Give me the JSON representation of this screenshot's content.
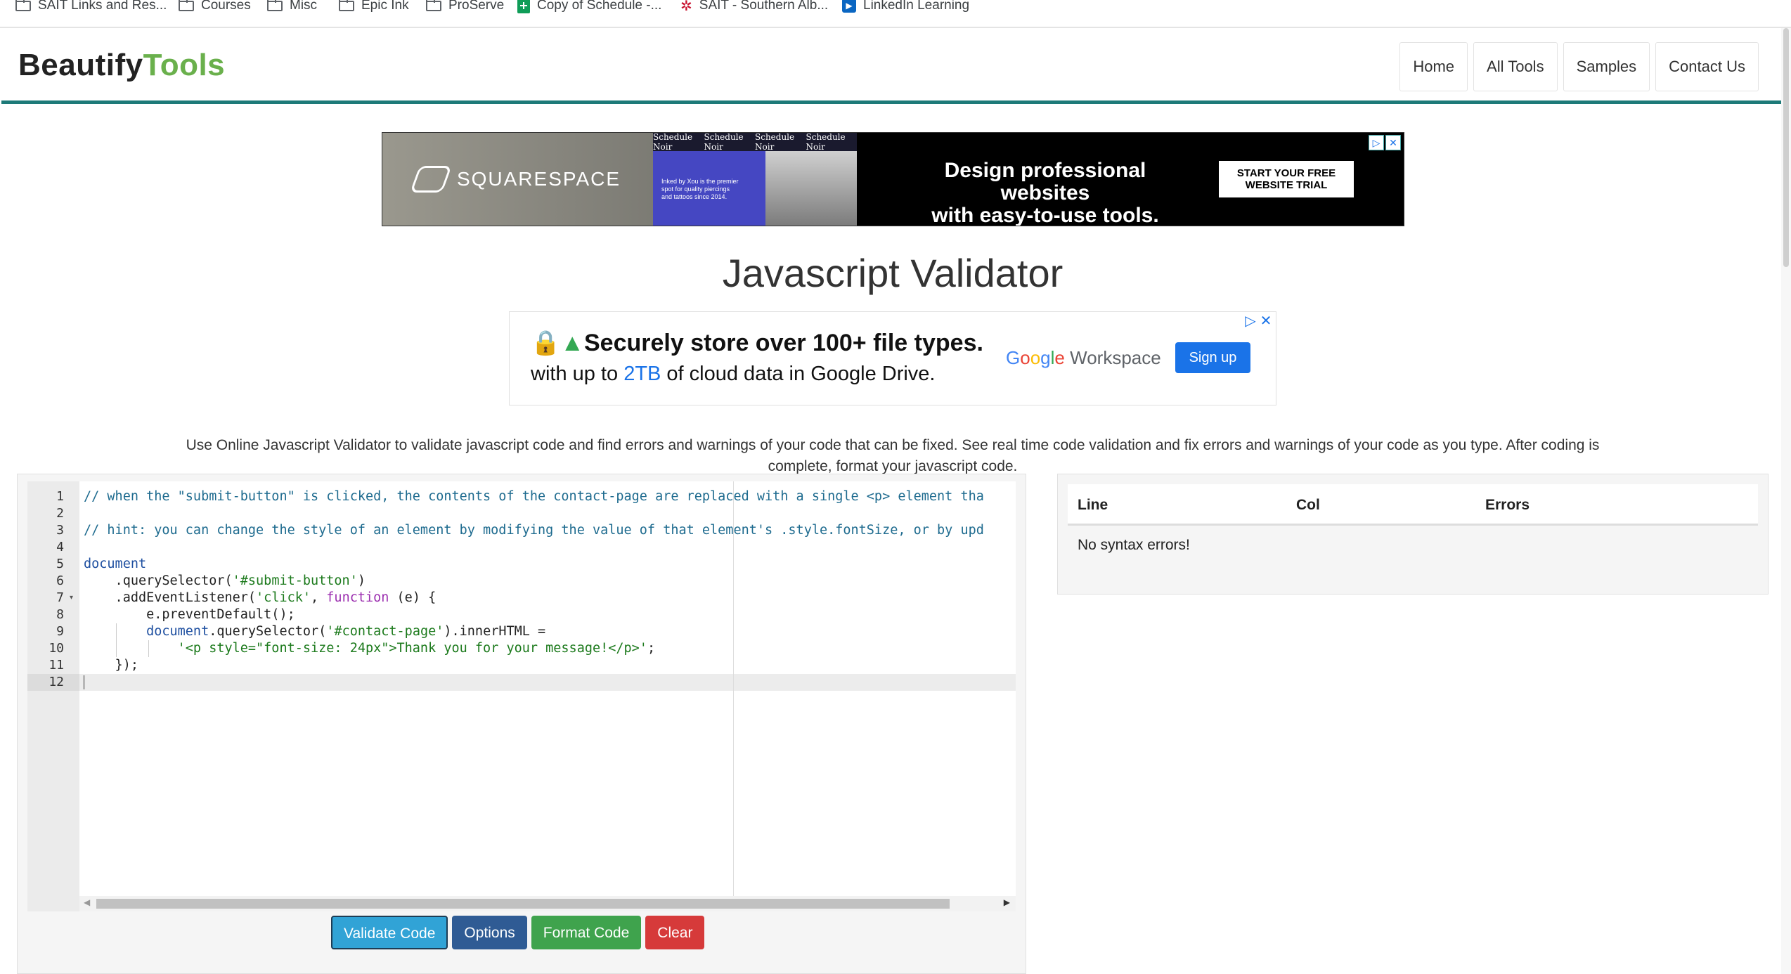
{
  "bookmarks": [
    {
      "label": "SAIT Links and Res...",
      "icon": "folder-icon"
    },
    {
      "label": "Courses",
      "icon": "folder-icon"
    },
    {
      "label": "Misc",
      "icon": "folder-icon"
    },
    {
      "label": "Epic Ink",
      "icon": "folder-icon"
    },
    {
      "label": "ProServe",
      "icon": "folder-icon"
    },
    {
      "label": "Copy of Schedule -...",
      "icon": "sheets-icon"
    },
    {
      "label": "SAIT - Southern Alb...",
      "icon": "sait-icon"
    },
    {
      "label": "LinkedIn Learning",
      "icon": "linkedin-learning-icon"
    }
  ],
  "logo": {
    "part1": "Beautify",
    "part2": "Tools"
  },
  "nav": {
    "home": "Home",
    "all_tools": "All Tools",
    "samples": "Samples",
    "contact": "Contact Us"
  },
  "ad1": {
    "brand": "SQUARESPACE",
    "strip_items": [
      "Schedule Noir",
      "Schedule Noir",
      "Schedule Noir",
      "Schedule Noir"
    ],
    "small_text": "Inked by Xou is the premier spot for quality piercings and tattoos since 2014.",
    "headline_line1": "Design professional websites",
    "headline_line2": "with easy-to-use tools.",
    "cta": "START YOUR FREE WEBSITE TRIAL"
  },
  "page_title": "Javascript Validator",
  "ad2": {
    "line1": "Securely store over 100+ file types.",
    "line2_pre": "with up to ",
    "line2_hl": "2TB",
    "line2_post": " of cloud data in Google Drive.",
    "brand_workspace": "Workspace",
    "signup": "Sign up"
  },
  "description": "Use Online Javascript Validator to validate javascript code and find errors and warnings of your code that can be fixed. See real time code validation and fix errors and warnings of your code as you type. After coding is complete, format your javascript code.",
  "editor": {
    "line_numbers": [
      "1",
      "2",
      "3",
      "4",
      "5",
      "6",
      "7",
      "8",
      "9",
      "10",
      "11",
      "12"
    ],
    "lines": {
      "l1": "// when the \"submit-button\" is clicked, the contents of the contact-page are replaced with a single <p> element tha",
      "l3": "// hint: you can change the style of an element by modifying the value of that element's .style.fontSize, or by upd",
      "l5": "document",
      "l6_a": "    .querySelector(",
      "l6_b": "'#submit-button'",
      "l6_c": ")",
      "l7_a": "    .addEventListener(",
      "l7_b": "'click'",
      "l7_c": ", ",
      "l7_d": "function",
      "l7_e": " (e) {",
      "l8": "        e.preventDefault();",
      "l9_a": "        ",
      "l9_b": "document",
      "l9_c": ".querySelector(",
      "l9_d": "'#contact-page'",
      "l9_e": ").innerHTML =",
      "l10_a": "            ",
      "l10_b": "'<p style=\"font-size: 24px\">Thank you for your message!</p>'",
      "l10_c": ";",
      "l11": "    });"
    }
  },
  "buttons": {
    "validate": "Validate Code",
    "options": "Options",
    "format": "Format Code",
    "clear": "Clear"
  },
  "results": {
    "headers": {
      "line": "Line",
      "col": "Col",
      "errors": "Errors"
    },
    "message": "No syntax errors!"
  }
}
